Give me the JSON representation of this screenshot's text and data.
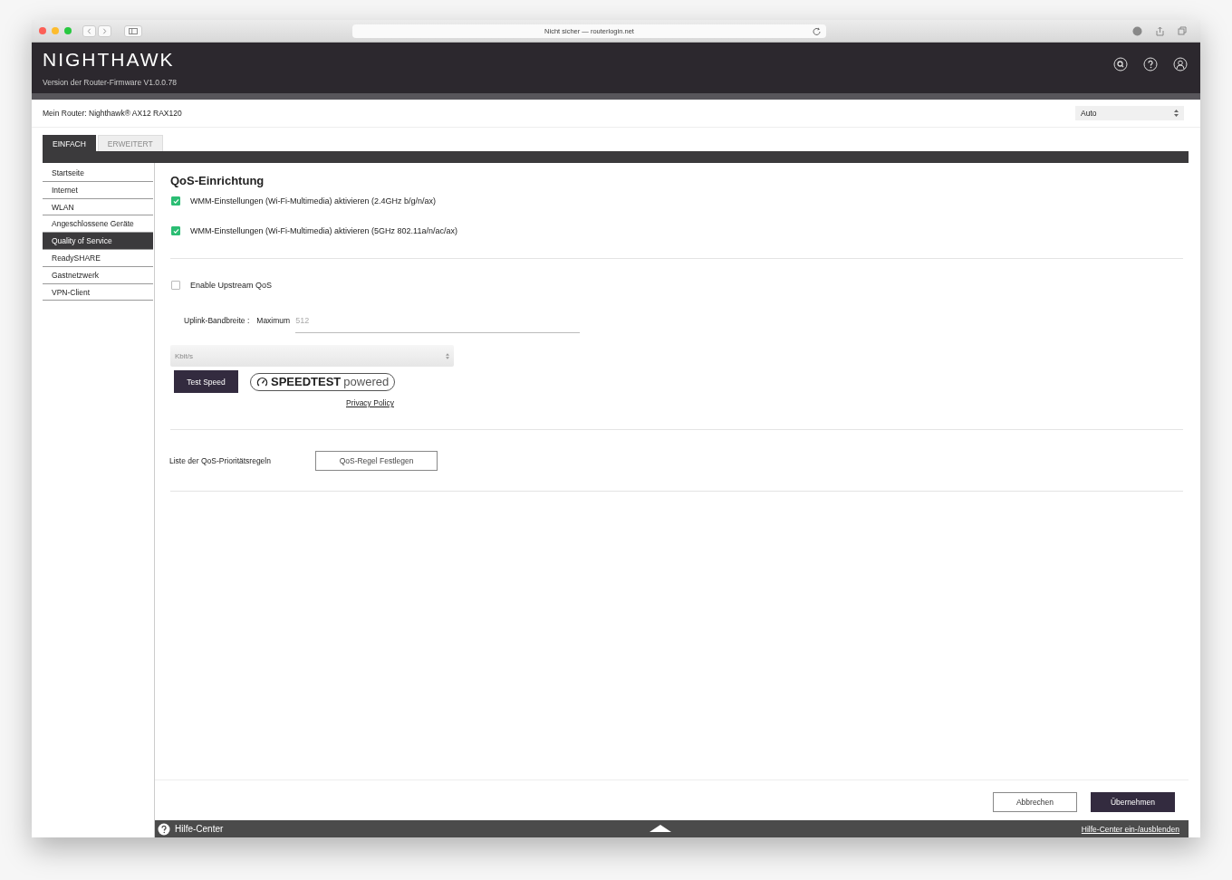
{
  "browser": {
    "address": "Nicht sicher — routerlogin.net"
  },
  "header": {
    "logo": "NIGHTHAWK",
    "firmware": "Version der Router-Firmware V1.0.0.78"
  },
  "router_bar": {
    "label": "Mein Router: Nighthawk® AX12 RAX120",
    "mode_select": "Auto"
  },
  "tabs": [
    {
      "label": "EINFACH",
      "selected": true
    },
    {
      "label": "ERWEITERT",
      "selected": false
    }
  ],
  "sidebar": {
    "items": [
      {
        "label": "Startseite",
        "selected": false
      },
      {
        "label": "Internet",
        "selected": false
      },
      {
        "label": "WLAN",
        "selected": false
      },
      {
        "label": "Angeschlossene Geräte",
        "selected": false
      },
      {
        "label": "Quality of Service",
        "selected": true
      },
      {
        "label": "ReadySHARE",
        "selected": false
      },
      {
        "label": "Gastnetzwerk",
        "selected": false
      },
      {
        "label": "VPN-Client",
        "selected": false
      }
    ]
  },
  "content": {
    "title": "QoS-Einrichtung",
    "wmm_options": [
      {
        "label": "WMM-Einstellungen (Wi-Fi-Multimedia) aktivieren (2.4GHz b/g/n/ax)",
        "checked": true
      },
      {
        "label": "WMM-Einstellungen (Wi-Fi-Multimedia) aktivieren (5GHz 802.11a/n/ac/ax)",
        "checked": true
      }
    ],
    "upstream": {
      "label": "Enable Upstream QoS",
      "checked": false
    },
    "uplink": {
      "label": "Uplink-Bandbreite :",
      "sub_label": "Maximum",
      "placeholder": "512"
    },
    "unit_select": {
      "value": "Kbit/s",
      "disabled": true
    },
    "test_speed_button": "Test Speed",
    "speedtest_badge": {
      "brand": "SPEEDTEST",
      "suffix": "powered"
    },
    "privacy_link": "Privacy Policy",
    "rules": {
      "label": "Liste der QoS-Prioritätsregeln",
      "button": "QoS-Regel Festlegen"
    },
    "actions": [
      {
        "label": "Abbrechen",
        "kind": "secondary"
      },
      {
        "label": "Übernehmen",
        "kind": "primary"
      }
    ]
  },
  "footer": {
    "help_label": "Hilfe-Center",
    "toggle_link": "Hilfe-Center ein-/ausblenden"
  }
}
